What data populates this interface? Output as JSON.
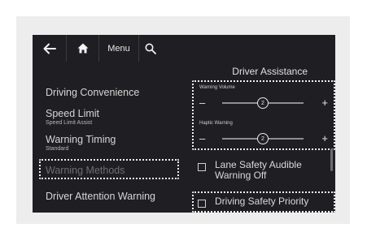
{
  "topbar": {
    "back_icon": "arrow-left-icon",
    "home_icon": "home-icon",
    "menu_label": "Menu",
    "search_icon": "search-icon"
  },
  "section_title": "Driver Assistance",
  "left_menu": [
    {
      "label": "Driving Convenience",
      "sub": ""
    },
    {
      "label": "Speed Limit",
      "sub": "Speed Limit Assist"
    },
    {
      "label": "Warning Timing",
      "sub": "Standard"
    },
    {
      "label": "Warning Methods",
      "sub": ""
    },
    {
      "label": "Driver Attention Warning",
      "sub": ""
    }
  ],
  "sliders": [
    {
      "label": "Warning Volume",
      "value": "2",
      "level": 0.5
    },
    {
      "label": "Haptic Warning",
      "value": "2",
      "level": 0.5
    }
  ],
  "slider_minus": "–",
  "slider_plus": "+",
  "options": [
    {
      "label": "Lane Safety Audible Warning Off",
      "checked": false
    },
    {
      "label": "Driving Safety Priority",
      "checked": false
    }
  ],
  "colors": {
    "screen_bg": "#1f1f23",
    "highlight_border": "#f0f0f0",
    "text": "#d9d9d9"
  }
}
